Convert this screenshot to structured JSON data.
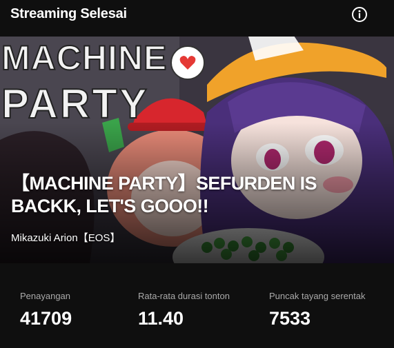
{
  "header": {
    "title": "Streaming Selesai",
    "info_icon": "info-circle-icon"
  },
  "banner": {
    "thumbnail_text": "MACHINE PARTY",
    "video_title": "【MACHINE PARTY】SEFURDEN IS BACKK, LET'S GOOO!!",
    "channel": "Mikazuki Arion【EOS】"
  },
  "stats": [
    {
      "label": "Penayangan",
      "value": "41709"
    },
    {
      "label": "Rata-rata durasi tonton",
      "value": "11.40"
    },
    {
      "label": "Puncak tayang serentak",
      "value": "7533"
    }
  ],
  "colors": {
    "background": "#0f0f0f",
    "text_primary": "#ffffff",
    "text_secondary": "#aaaaaa"
  }
}
